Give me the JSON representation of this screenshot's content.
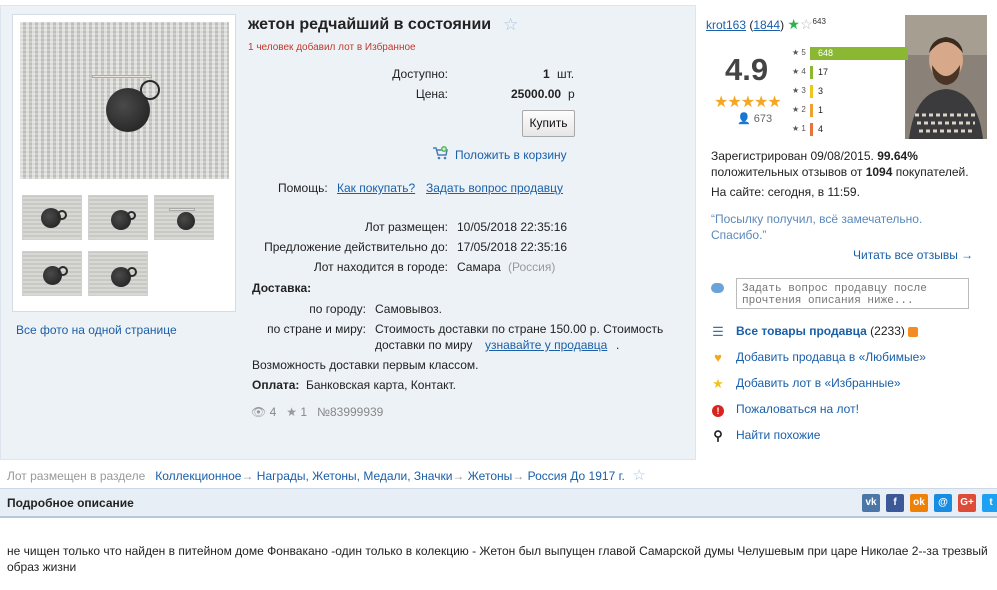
{
  "lot": {
    "title": "жетон редчайший в состоянии",
    "favorites_note": "1 человек добавил лот в Избранное",
    "available_label": "Доступно:",
    "available_value": "1",
    "available_unit": "шт.",
    "price_label": "Цена:",
    "price_value": "25000.00",
    "price_unit": "р",
    "buy_label": "Купить",
    "cart_label": "Положить в корзину",
    "help_label": "Помощь:",
    "help_link1": "Как покупать?",
    "help_link2": "Задать вопрос продавцу",
    "posted_label": "Лот размещен:",
    "posted_value": "10/05/2018 22:35:16",
    "valid_label": "Предложение действительно до:",
    "valid_value": "17/05/2018 22:35:16",
    "city_label": "Лот находится в городе:",
    "city_value": "Самара",
    "country_value": "(Россия)",
    "delivery_label": "Доставка:",
    "by_city_label": "по городу:",
    "by_city_value": "Самовывоз.",
    "by_country_label": "по стране и миру:",
    "by_country_value_1": "Стоимость доставки по стране 150.00 р. Стоимость",
    "by_country_value_2": "доставки по миру",
    "by_country_link": "узнавайте у продавца",
    "first_class": "Возможность доставки первым классом.",
    "payment_label": "Оплата:",
    "payment_value": "Банковская карта, Контакт.",
    "views": "4",
    "favs": "1",
    "lot_number": "№83999939",
    "all_photos": "Все фото на одной странице"
  },
  "seller": {
    "name": "krot163",
    "count": "(1844)",
    "star_count": "643",
    "rating": "4.9",
    "users": "673",
    "bars": [
      {
        "label": "5",
        "count": "648",
        "fraction": 1.0,
        "color": "#8ab832"
      },
      {
        "label": "4",
        "count": "17",
        "fraction": 0.026,
        "color": "#8ab832"
      },
      {
        "label": "3",
        "count": "3",
        "fraction": 0.005,
        "color": "#f0c419"
      },
      {
        "label": "2",
        "count": "1",
        "fraction": 0.002,
        "color": "#f0a030"
      },
      {
        "label": "1",
        "count": "4",
        "fraction": 0.006,
        "color": "#e8743b"
      }
    ],
    "registered_text": "Зарегистрирован 09/08/2015.",
    "percent": "99.64%",
    "reviews_text": "положительных отзывов от",
    "reviews_count": "1094",
    "buyers_text": "покупателей.",
    "online": "На сайте: сегодня, в 11:59.",
    "quote": "“Посылку получил, всё замечательно. Спасибо.”",
    "read_all": "Читать все отзывы →",
    "ask_placeholder": "Задать вопрос продавцу после прочтения описания ниже...",
    "all_goods": "Все товары продавца",
    "all_goods_count": "(2233)",
    "add_fav_seller": "Добавить продавца в «Любимые»",
    "add_fav_lot": "Добавить лот в «Избранные»",
    "complain": "Пожаловаться на лот!",
    "find_similar": "Найти похожие"
  },
  "breadcrumbs": {
    "prefix": "Лот размещен в разделе",
    "items": [
      "Коллекционное",
      "Награды, Жетоны, Медали, Значки",
      "Жетоны",
      "Россия До 1917 г."
    ]
  },
  "description": {
    "title": "Подробное описание",
    "text": "не чищен только что найден в питейном доме Фонвакано -один только в колекцию - Жетон был выпущен главой Самарской думы Челушевым при царе Николае 2--за трезвый образ жизни"
  },
  "social": [
    {
      "name": "vk",
      "glyph": "vk",
      "color": "#4a76a8"
    },
    {
      "name": "facebook",
      "glyph": "f",
      "color": "#3b5998"
    },
    {
      "name": "odnoklassniki",
      "glyph": "ok",
      "color": "#ee8208"
    },
    {
      "name": "moimir",
      "glyph": "@",
      "color": "#168de2"
    },
    {
      "name": "googleplus",
      "glyph": "G+",
      "color": "#dd4b39"
    },
    {
      "name": "twitter",
      "glyph": "t",
      "color": "#1da1f2"
    }
  ]
}
